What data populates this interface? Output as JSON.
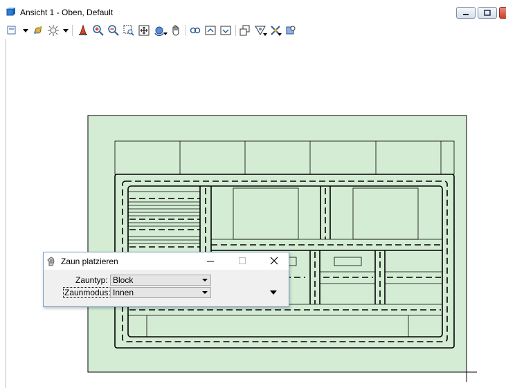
{
  "window": {
    "title": "Ansicht 1 - Oben, Default",
    "icon": "view-cube-icon"
  },
  "toolbar": {
    "icons": [
      "view-attributes-icon",
      "view-display-style-icon",
      "render-icon",
      "update-view-icon",
      "zoom-in-icon",
      "zoom-out-icon",
      "window-area-icon",
      "fit-view-icon",
      "rotate-view-icon",
      "pan-view-icon",
      "view-previous-icon",
      "view-next-icon",
      "copy-view-icon",
      "clip-volume-icon",
      "clip-mask-icon",
      "camera-icon",
      "change-view-perspective-icon"
    ]
  },
  "colors": {
    "drawing_fill": "#d4ecd4",
    "dialog_border": "#7aa0c8",
    "close_button": "#c9412a"
  },
  "dialog": {
    "title": "Zaun platzieren",
    "icon": "fence-tool-icon",
    "fields": {
      "fence_type_label": "Zauntyp:",
      "fence_type_value": "Block",
      "fence_mode_label": "Zaunmodus:",
      "fence_mode_value": "Innen"
    }
  }
}
